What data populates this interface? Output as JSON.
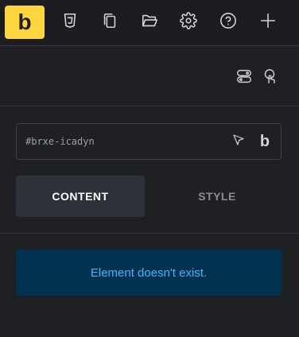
{
  "toolbar": {
    "logo_letter": "b",
    "icons": [
      "css3-icon",
      "pages-icon",
      "folder-icon",
      "settings-icon",
      "help-icon",
      "add-icon"
    ]
  },
  "panel": {
    "element_id": "#brxe-icadyn",
    "id_logo_letter": "b",
    "tabs": [
      {
        "label": "CONTENT",
        "active": true
      },
      {
        "label": "STYLE",
        "active": false
      }
    ],
    "notice": "Element doesn't exist."
  },
  "colors": {
    "accent": "#ffd53d",
    "notice_bg": "#003250",
    "notice_text": "#3db5ff"
  }
}
